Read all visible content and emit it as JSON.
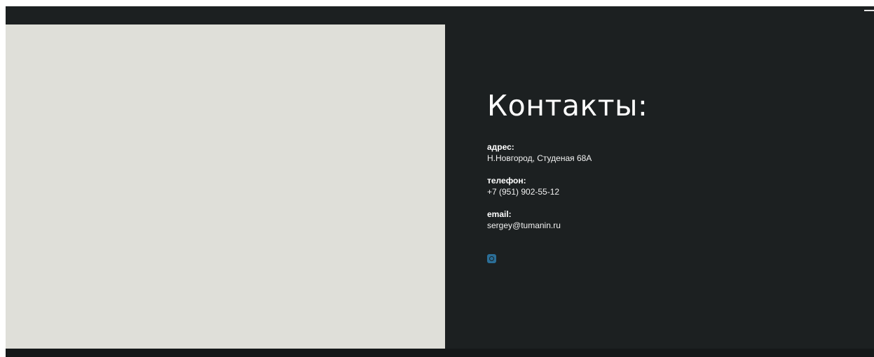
{
  "contacts": {
    "title": "Контакты:",
    "address_label": "адрес:",
    "address_value": "Н.Новгород, Студеная 68А",
    "phone_label": "телефон:",
    "phone_value": "+7 (951) 902-55-12",
    "email_label": "email:",
    "email_value": "sergey@tumanin.ru",
    "social_icon": "instagram-icon"
  },
  "colors": {
    "background_dark": "#1c2021",
    "image_panel": "#dfdfd9",
    "social_accent": "#2b6e97",
    "text": "#ffffff"
  }
}
